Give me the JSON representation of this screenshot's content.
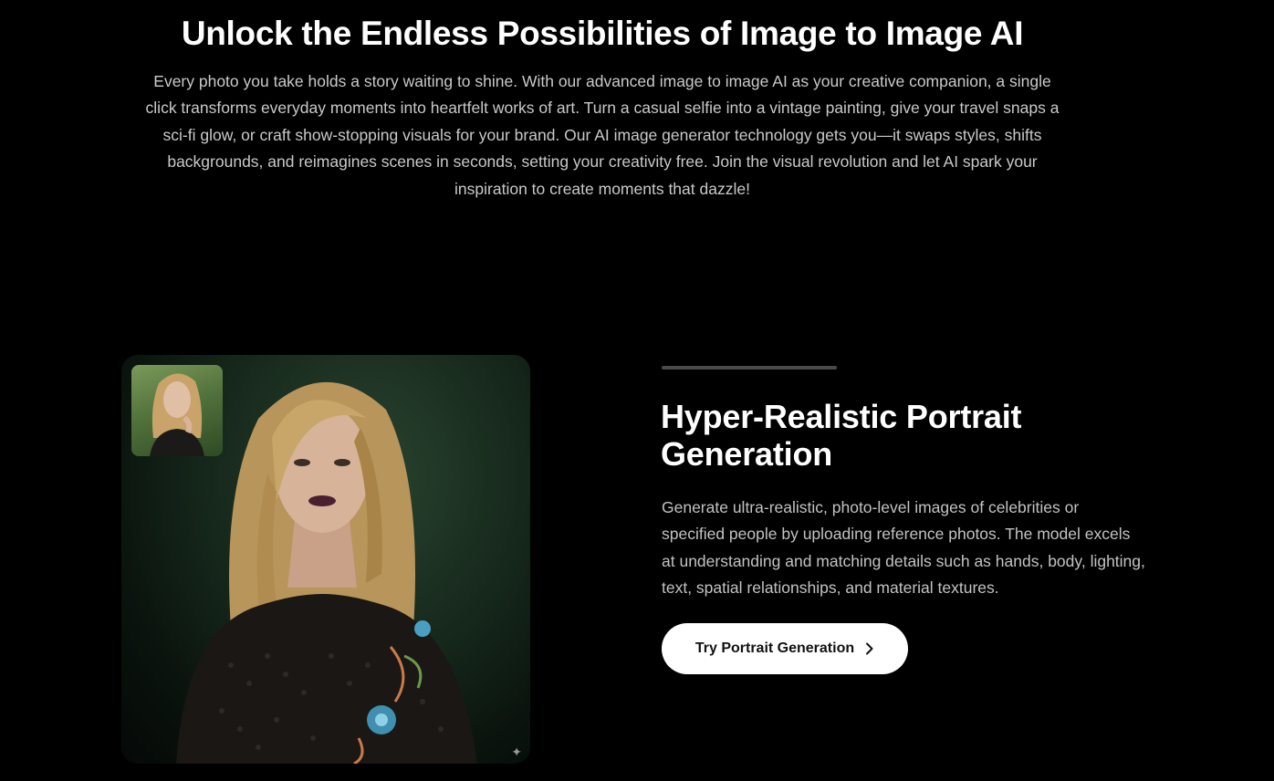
{
  "intro": {
    "title": "Unlock the Endless Possibilities of Image to Image AI",
    "body": "Every photo you take holds a story waiting to shine. With our advanced image to image AI as your creative companion, a single click transforms everyday moments into heartfelt works of art. Turn a casual selfie into a vintage painting, give your travel snaps a sci-fi glow, or craft show-stopping visuals for your brand. Our AI image generator technology gets you—it swaps styles, shifts backgrounds, and reimagines scenes in seconds, setting your creativity free. Join the visual revolution and let AI spark your inspiration to create moments that dazzle!"
  },
  "feature": {
    "title": "Hyper-Realistic Portrait Generation",
    "description": "Generate ultra-realistic, photo-level images of celebrities or specified people by uploading reference photos. The model excels at understanding and matching details such as hands, body, lighting, text, spatial relationships, and material textures.",
    "cta_label": "Try Portrait Generation",
    "cta_icon": "chevron-right-icon",
    "media_icon": "sparkle-icon"
  },
  "colors": {
    "background": "#000000",
    "text_primary": "#ffffff",
    "text_secondary": "#c2c2c2",
    "accent_bar": "#4a4a4a",
    "button_bg": "#ffffff",
    "button_text": "#111111"
  }
}
